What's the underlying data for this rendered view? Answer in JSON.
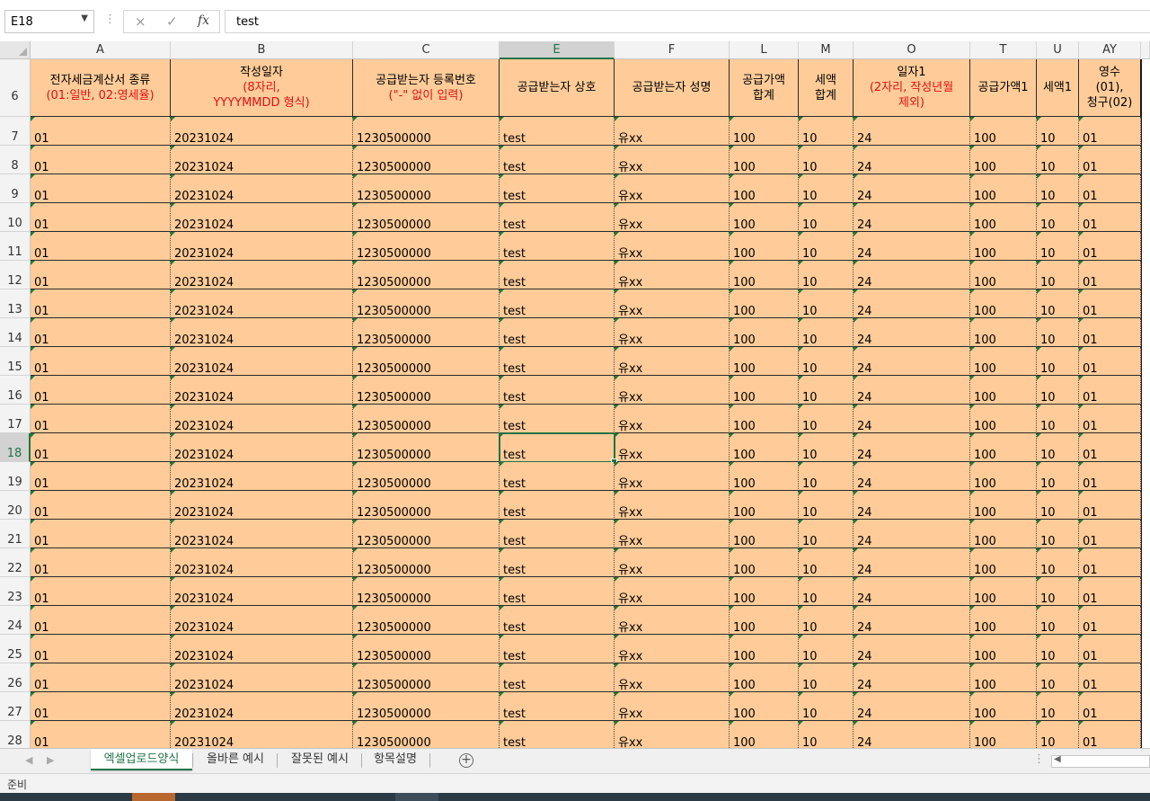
{
  "formula_bar": {
    "name_box": "E18",
    "cancel_icon": "×",
    "enter_icon": "✓",
    "function_icon": "fx",
    "content": "test"
  },
  "grid": {
    "columns": [
      "A",
      "B",
      "C",
      "E",
      "F",
      "L",
      "M",
      "O",
      "T",
      "U",
      "AY"
    ],
    "selected_column": "E",
    "header_row_number": "6",
    "header": [
      {
        "lines": [
          "전자세금계산서 종류"
        ],
        "red": [
          "(01:일반, 02:영세율)"
        ]
      },
      {
        "lines": [
          "작성일자"
        ],
        "red": [
          "(8자리,",
          "YYYYMMDD 형식)"
        ]
      },
      {
        "lines": [
          "공급받는자 등록번호"
        ],
        "red": [
          "(\"-\" 없이 입력)"
        ]
      },
      {
        "lines": [
          "공급받는자 상호"
        ],
        "red": []
      },
      {
        "lines": [
          "공급받는자 성명"
        ],
        "red": []
      },
      {
        "lines": [
          "공급가액",
          "합계"
        ],
        "red": []
      },
      {
        "lines": [
          "세액",
          "합계"
        ],
        "red": []
      },
      {
        "lines": [
          "일자1"
        ],
        "red": [
          "(2자리, 작성년월",
          "제외)"
        ]
      },
      {
        "lines": [
          "공급가액1"
        ],
        "red": []
      },
      {
        "lines": [
          "세액1"
        ],
        "red": []
      },
      {
        "lines": [
          "영수",
          "(01),",
          "청구(02)"
        ],
        "red": []
      }
    ],
    "selected_row": "18",
    "rows": [
      {
        "num": "7",
        "cells": [
          "01",
          "20231024",
          "1230500000",
          "test",
          "유xx",
          "100",
          "10",
          "24",
          "100",
          "10",
          "01"
        ]
      },
      {
        "num": "8",
        "cells": [
          "01",
          "20231024",
          "1230500000",
          "test",
          "유xx",
          "100",
          "10",
          "24",
          "100",
          "10",
          "01"
        ]
      },
      {
        "num": "9",
        "cells": [
          "01",
          "20231024",
          "1230500000",
          "test",
          "유xx",
          "100",
          "10",
          "24",
          "100",
          "10",
          "01"
        ]
      },
      {
        "num": "10",
        "cells": [
          "01",
          "20231024",
          "1230500000",
          "test",
          "유xx",
          "100",
          "10",
          "24",
          "100",
          "10",
          "01"
        ]
      },
      {
        "num": "11",
        "cells": [
          "01",
          "20231024",
          "1230500000",
          "test",
          "유xx",
          "100",
          "10",
          "24",
          "100",
          "10",
          "01"
        ]
      },
      {
        "num": "12",
        "cells": [
          "01",
          "20231024",
          "1230500000",
          "test",
          "유xx",
          "100",
          "10",
          "24",
          "100",
          "10",
          "01"
        ]
      },
      {
        "num": "13",
        "cells": [
          "01",
          "20231024",
          "1230500000",
          "test",
          "유xx",
          "100",
          "10",
          "24",
          "100",
          "10",
          "01"
        ]
      },
      {
        "num": "14",
        "cells": [
          "01",
          "20231024",
          "1230500000",
          "test",
          "유xx",
          "100",
          "10",
          "24",
          "100",
          "10",
          "01"
        ]
      },
      {
        "num": "15",
        "cells": [
          "01",
          "20231024",
          "1230500000",
          "test",
          "유xx",
          "100",
          "10",
          "24",
          "100",
          "10",
          "01"
        ]
      },
      {
        "num": "16",
        "cells": [
          "01",
          "20231024",
          "1230500000",
          "test",
          "유xx",
          "100",
          "10",
          "24",
          "100",
          "10",
          "01"
        ]
      },
      {
        "num": "17",
        "cells": [
          "01",
          "20231024",
          "1230500000",
          "test",
          "유xx",
          "100",
          "10",
          "24",
          "100",
          "10",
          "01"
        ]
      },
      {
        "num": "18",
        "cells": [
          "01",
          "20231024",
          "1230500000",
          "test",
          "유xx",
          "100",
          "10",
          "24",
          "100",
          "10",
          "01"
        ]
      },
      {
        "num": "19",
        "cells": [
          "01",
          "20231024",
          "1230500000",
          "test",
          "유xx",
          "100",
          "10",
          "24",
          "100",
          "10",
          "01"
        ]
      },
      {
        "num": "20",
        "cells": [
          "01",
          "20231024",
          "1230500000",
          "test",
          "유xx",
          "100",
          "10",
          "24",
          "100",
          "10",
          "01"
        ]
      },
      {
        "num": "21",
        "cells": [
          "01",
          "20231024",
          "1230500000",
          "test",
          "유xx",
          "100",
          "10",
          "24",
          "100",
          "10",
          "01"
        ]
      },
      {
        "num": "22",
        "cells": [
          "01",
          "20231024",
          "1230500000",
          "test",
          "유xx",
          "100",
          "10",
          "24",
          "100",
          "10",
          "01"
        ]
      },
      {
        "num": "23",
        "cells": [
          "01",
          "20231024",
          "1230500000",
          "test",
          "유xx",
          "100",
          "10",
          "24",
          "100",
          "10",
          "01"
        ]
      },
      {
        "num": "24",
        "cells": [
          "01",
          "20231024",
          "1230500000",
          "test",
          "유xx",
          "100",
          "10",
          "24",
          "100",
          "10",
          "01"
        ]
      },
      {
        "num": "25",
        "cells": [
          "01",
          "20231024",
          "1230500000",
          "test",
          "유xx",
          "100",
          "10",
          "24",
          "100",
          "10",
          "01"
        ]
      },
      {
        "num": "26",
        "cells": [
          "01",
          "20231024",
          "1230500000",
          "test",
          "유xx",
          "100",
          "10",
          "24",
          "100",
          "10",
          "01"
        ]
      },
      {
        "num": "27",
        "cells": [
          "01",
          "20231024",
          "1230500000",
          "test",
          "유xx",
          "100",
          "10",
          "24",
          "100",
          "10",
          "01"
        ]
      },
      {
        "num": "28",
        "cells": [
          "01",
          "20231024",
          "1230500000",
          "test",
          "유xx",
          "100",
          "10",
          "24",
          "100",
          "10",
          "01"
        ]
      }
    ]
  },
  "sheet_tabs": {
    "tabs": [
      "엑셀업로드양식",
      "올바른 예시",
      "잘못된 예시",
      "항목설명"
    ],
    "active": "엑셀업로드양식",
    "nav_prev": "◀",
    "nav_next": "▶",
    "add_sheet": "+"
  },
  "status_bar": {
    "text": "준비"
  },
  "colors": {
    "cell_fill": "#ffcc99",
    "excel_green": "#217346",
    "header_red": "#e01010"
  }
}
